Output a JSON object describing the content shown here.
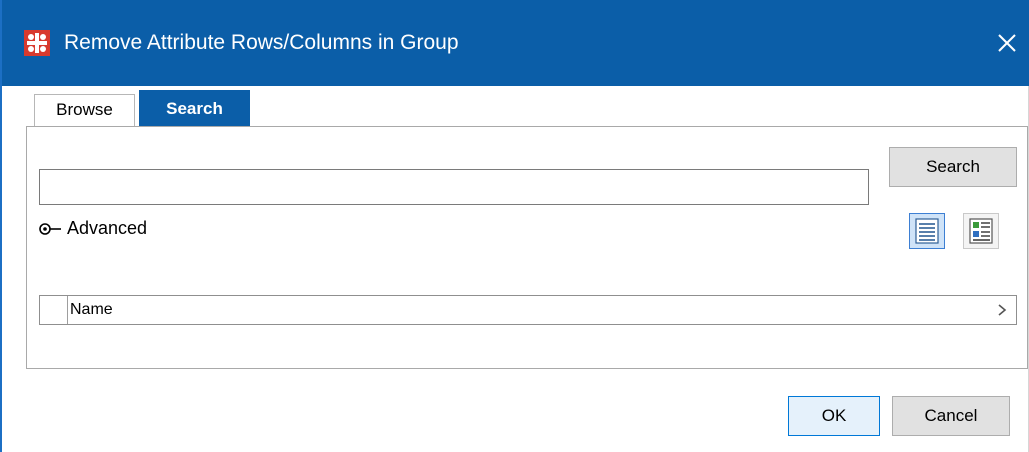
{
  "window": {
    "title": "Remove Attribute Rows/Columns in Group",
    "app_icon": "grid-cross-icon",
    "close_icon": "close-icon",
    "title_bar_color": "#0b5ea8"
  },
  "tabs": [
    {
      "label": "Browse",
      "active": false
    },
    {
      "label": "Search",
      "active": true
    }
  ],
  "search": {
    "value": "",
    "placeholder": "",
    "button_label": "Search"
  },
  "advanced": {
    "label": "Advanced",
    "icon": "toggle-arrow-icon"
  },
  "view_modes": [
    {
      "name": "list-view-icon",
      "selected": true
    },
    {
      "name": "details-view-icon",
      "selected": false
    }
  ],
  "table": {
    "columns": [
      "Name"
    ],
    "scroll_icon": "chevron-right-icon"
  },
  "footer": {
    "ok_label": "OK",
    "cancel_label": "Cancel"
  }
}
